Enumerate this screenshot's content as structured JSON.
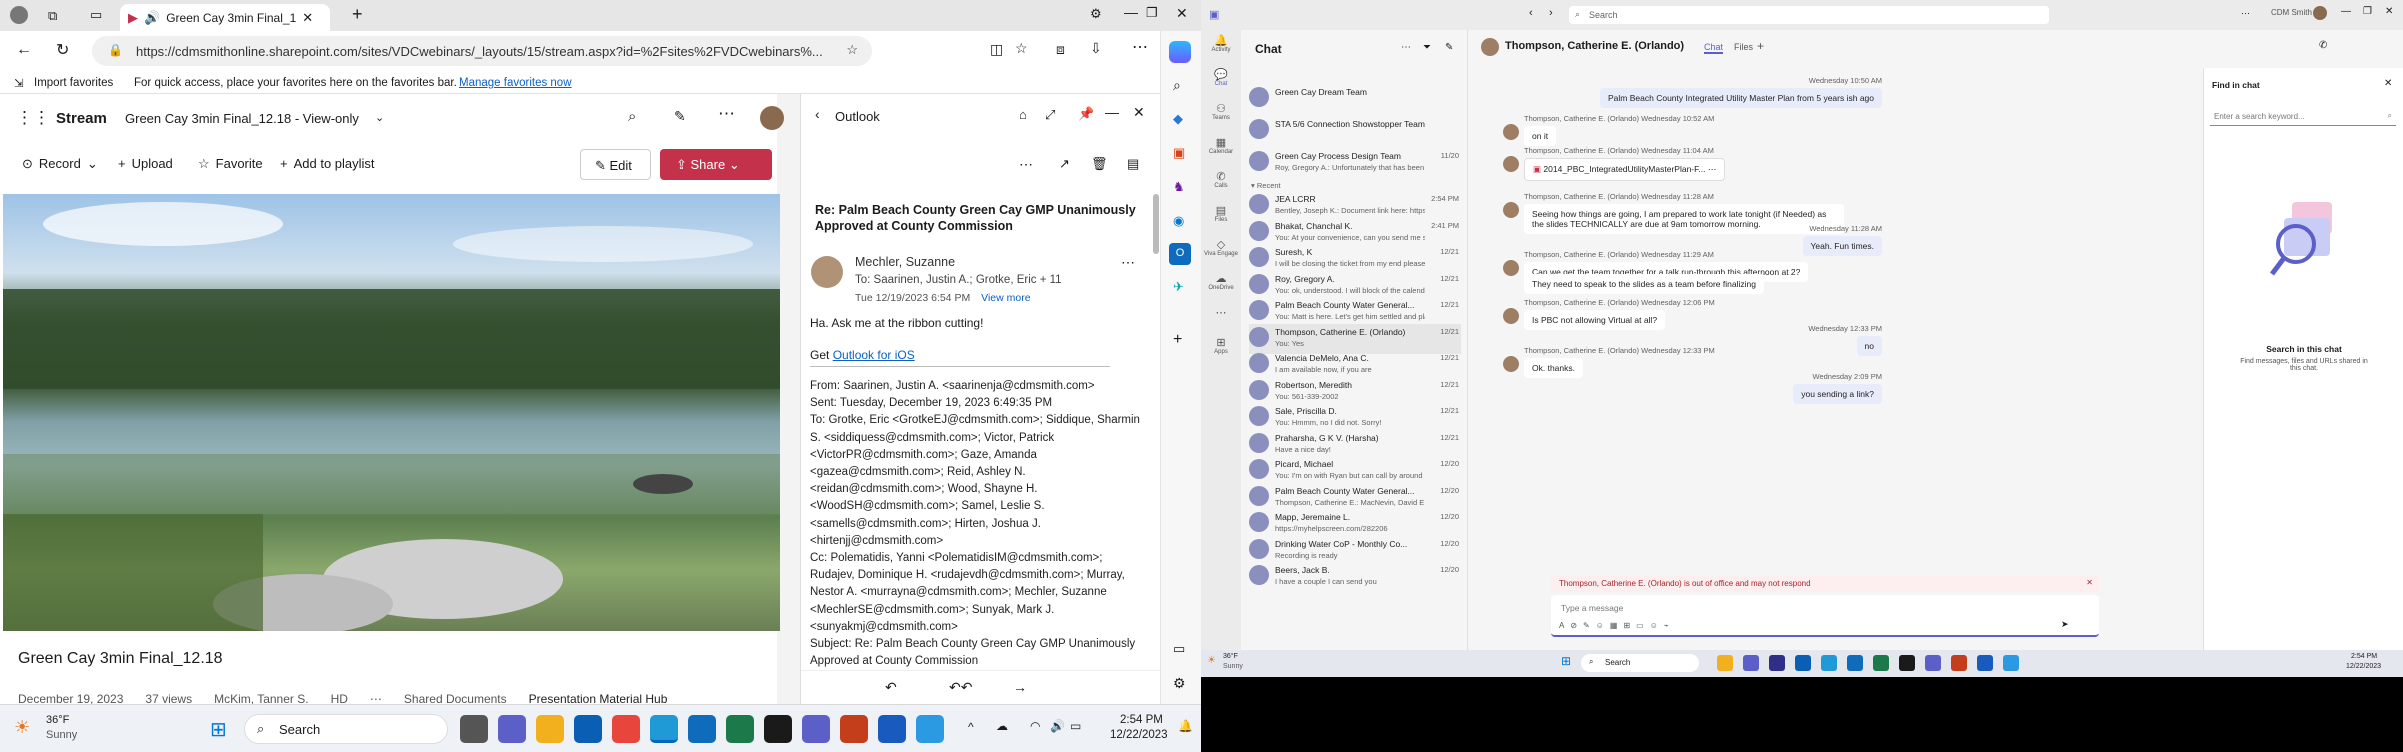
{
  "browser": {
    "tab_title": "Green Cay 3min Final_12.18",
    "url": "https://cdmsmithonline.sharepoint.com/sites/VDCwebinars/_layouts/15/stream.aspx?id=%2Fsites%2FVDCwebinars%...",
    "fav_import": "Import favorites",
    "fav_hint": "For quick access, place your favorites here on the favorites bar.",
    "fav_link": "Manage favorites now"
  },
  "stream": {
    "app": "Stream",
    "doc_title": "Green Cay 3min Final_12.18 - View-only",
    "record": "Record",
    "upload": "Upload",
    "favorite": "Favorite",
    "playlist": "Add to playlist",
    "edit": "Edit",
    "share": "Share",
    "video_title": "Green Cay 3min Final_12.18",
    "date": "December 19, 2023",
    "views": "37 views",
    "author": "McKim, Tanner S.",
    "hd": "HD",
    "crumb1": "Shared Documents",
    "crumb2": "Presentation Material Hub"
  },
  "outlook": {
    "title": "Outlook",
    "subject": "Re: Palm Beach County Green Cay GMP Unanimously Approved at County Commission",
    "sender": "Mechler, Suzanne",
    "to": "To: Saarinen, Justin A.;  Grotke, Eric  + 11",
    "time": "Tue 12/19/2023 6:54 PM",
    "view_more": "View more",
    "body1": "Ha. Ask me at the ribbon cutting!",
    "get": "Get ",
    "ios_link": "Outlook for iOS",
    "from_line": "From: Saarinen, Justin A. <saarinenja@cdmsmith.com>",
    "sent_line": "Sent: Tuesday, December 19, 2023 6:49:35 PM",
    "to_lines": "To: Grotke, Eric <GrotkeEJ@cdmsmith.com>; Siddique, Sharmin S. <siddiquess@cdmsmith.com>; Victor, Patrick <VictorPR@cdmsmith.com>; Gaze, Amanda <gazea@cdmsmith.com>; Reid, Ashley N. <reidan@cdmsmith.com>; Wood, Shayne H. <WoodSH@cdmsmith.com>; Samel, Leslie S. <samells@cdmsmith.com>; Hirten, Joshua J. <hirtenjj@cdmsmith.com>",
    "cc_lines": "Cc: Polematidis, Yanni <PolematidisIM@cdmsmith.com>; Rudajev, Dominique H. <rudajevdh@cdmsmith.com>; Murray, Nestor A. <murrayna@cdmsmith.com>; Mechler, Suzanne <MechlerSE@cdmsmith.com>; Sunyak, Mark J. <sunyakmj@cdmsmith.com>",
    "subject_line": "Subject: Re: Palm Beach County Green Cay GMP Unanimously Approved at County Commission"
  },
  "taskbar1": {
    "temp": "36°F",
    "weather": "Sunny",
    "search": "Search",
    "time": "2:54 PM",
    "date": "12/22/2023"
  },
  "teams": {
    "search": "Search",
    "user": "CDM Smith",
    "chat_header": "Chat",
    "recent": "Recent",
    "rail": [
      "Activity",
      "Chat",
      "Teams",
      "Calendar",
      "Calls",
      "Files",
      "Viva Engage",
      "OneDrive",
      "Apps"
    ],
    "pinned": [
      {
        "name": "Green Cay Dream Team",
        "preview": "",
        "date": ""
      },
      {
        "name": "STA 5/6 Connection Showstopper Team",
        "preview": "",
        "date": ""
      },
      {
        "name": "Green Cay Process Design Team",
        "preview": "Roy, Gregory A.: Unfortunately that has been pl...",
        "date": "11/20"
      }
    ],
    "chats": [
      {
        "name": "JEA LCRR",
        "preview": "Bentley, Joseph K.: Document link here: https...",
        "date": "2:54 PM"
      },
      {
        "name": "Bhakat, Chanchal K.",
        "preview": "You: At your convenience, can you send me so...",
        "date": "2:41 PM"
      },
      {
        "name": "Suresh, K",
        "preview": "I will be closing the ticket from my end please l...",
        "date": "12/21"
      },
      {
        "name": "Roy, Gregory A.",
        "preview": "You: ok, understood. I will block of the calendar...",
        "date": "12/21"
      },
      {
        "name": "Palm Beach County Water General...",
        "preview": "You: Matt is here. Let's get him settled and plan...",
        "date": "12/21"
      },
      {
        "name": "Thompson, Catherine E. (Orlando)",
        "preview": "You: Yes",
        "date": "12/21"
      },
      {
        "name": "Valencia DeMelo, Ana C.",
        "preview": "I am available now, if you are",
        "date": "12/21"
      },
      {
        "name": "Robertson, Meredith",
        "preview": "You: 561-339-2002",
        "date": "12/21"
      },
      {
        "name": "Sale, Priscilla D.",
        "preview": "You: Hmmm, no I did not. Sorry!",
        "date": "12/21"
      },
      {
        "name": "Praharsha, G K V. (Harsha)",
        "preview": "Have a nice day!",
        "date": "12/21"
      },
      {
        "name": "Picard, Michael",
        "preview": "You: I'm on with Ryan but can call by around 3?...",
        "date": "12/20"
      },
      {
        "name": "Palm Beach County Water General...",
        "preview": "Thompson, Catherine E.: MacNevin, David E. Ar...",
        "date": "12/20"
      },
      {
        "name": "Mapp, Jeremaine L.",
        "preview": "https://myhelpscreen.com/282206",
        "date": "12/20"
      },
      {
        "name": "Drinking Water CoP - Monthly Co...",
        "preview": "Recording is ready",
        "date": "12/20"
      },
      {
        "name": "Beers, Jack B.",
        "preview": "I have a couple I can send you",
        "date": "12/20"
      }
    ],
    "conv_name": "Thompson, Catherine E. (Orlando)",
    "tab_chat": "Chat",
    "tab_files": "Files",
    "messages": [
      {
        "mine": true,
        "meta": "Wednesday 10:50 AM",
        "text": "Palm Beach County Integrated Utility Master Plan from 5 years ish ago"
      },
      {
        "mine": false,
        "meta": "Thompson, Catherine E. (Orlando)   Wednesday 10:52 AM",
        "text": "on it"
      },
      {
        "mine": false,
        "meta": "Thompson, Catherine E. (Orlando)   Wednesday 11:04 AM",
        "text": "2014_PBC_IntegratedUtilityMasterPlan-F..."
      },
      {
        "mine": false,
        "meta": "Thompson, Catherine E. (Orlando)   Wednesday 11:28 AM",
        "text": "Seeing how things are going, I am prepared to work late tonight (if Needed) as the slides TECHNICALLY are due at 9am tomorrow morning."
      },
      {
        "mine": true,
        "meta": "Wednesday 11:28 AM",
        "text": "Yeah. Fun times."
      },
      {
        "mine": false,
        "meta": "Thompson, Catherine E. (Orlando)   Wednesday 11:29 AM",
        "text": "Can we get the team together for a talk run-through this afternoon at 2?"
      },
      {
        "mine": false,
        "meta": "",
        "text": "They need to speak to the slides as a team before finalizing"
      },
      {
        "mine": false,
        "meta": "Thompson, Catherine E. (Orlando)   Wednesday 12:06 PM",
        "text": "Is PBC not allowing Virtual at all?"
      },
      {
        "mine": true,
        "meta": "Wednesday 12:33 PM",
        "text": "no"
      },
      {
        "mine": false,
        "meta": "Thompson, Catherine E. (Orlando)   Wednesday 12:33 PM",
        "text": "Ok. thanks."
      },
      {
        "mine": true,
        "meta": "Wednesday 2:09 PM",
        "text": "you sending a link?"
      }
    ],
    "ooo": "Thompson, Catherine E. (Orlando) is out of office and may not respond",
    "compose": "Type a message",
    "find_title": "Find in chat",
    "find_placeholder": "Enter a search keyword...",
    "find_heading": "Search in this chat",
    "find_desc": "Find messages, files and URLs shared in this chat."
  },
  "taskbar2": {
    "temp": "36°F",
    "weather": "Sunny",
    "search": "Search",
    "time": "2:54 PM",
    "date": "12/22/2023"
  }
}
